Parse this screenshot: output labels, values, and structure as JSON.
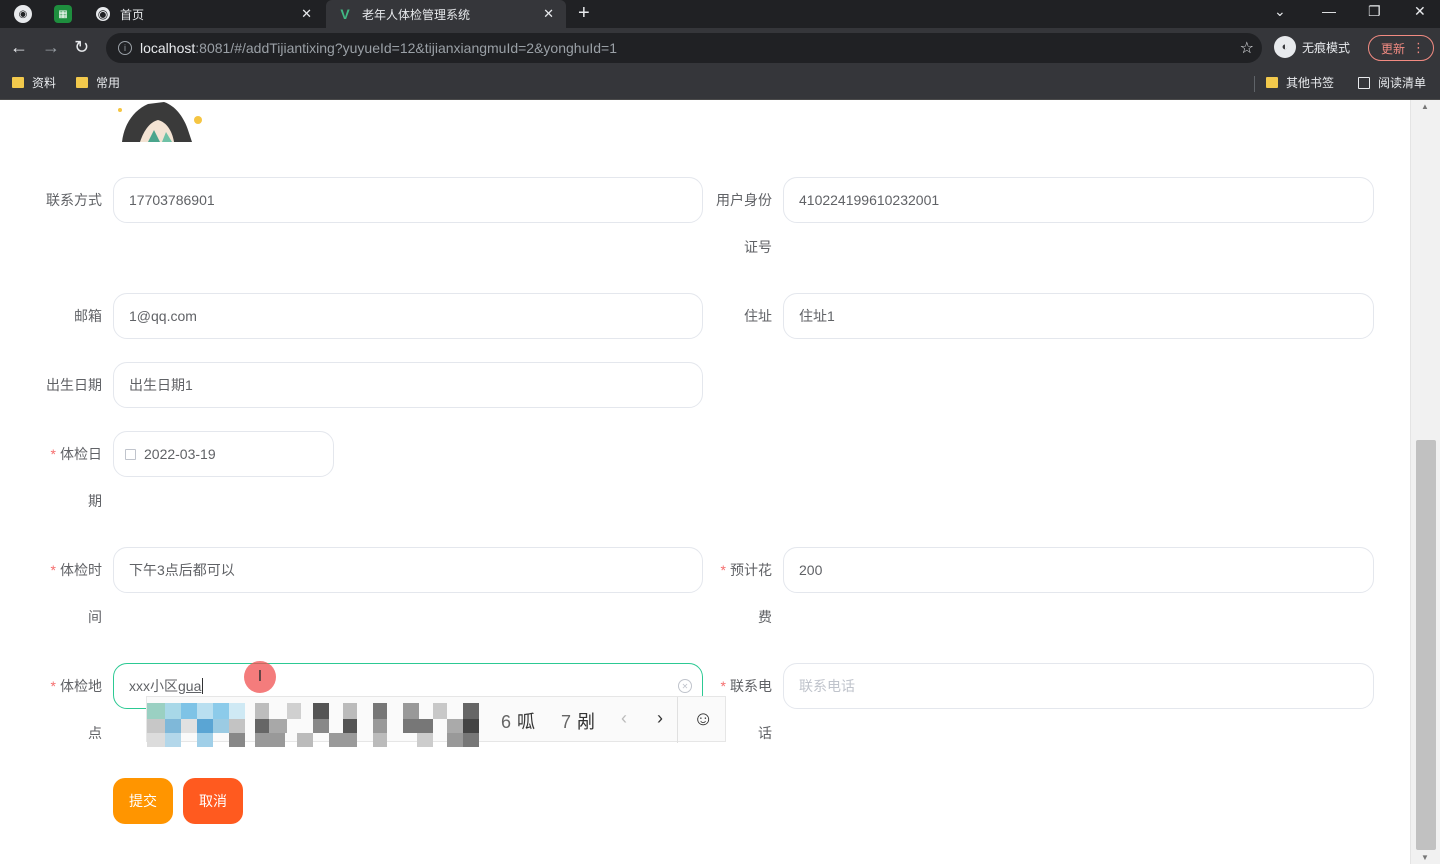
{
  "browser": {
    "tabs": [
      {
        "label": "首页",
        "active": false
      },
      {
        "label": "老年人体检管理系统",
        "active": true
      }
    ],
    "url_host": "localhost",
    "url_rest": ":8081/#/addTijiantixing?yuyueId=12&tijianxiangmuId=2&yonghuId=1",
    "incognito_label": "无痕模式",
    "update_label": "更新",
    "bookmarks": [
      "资料",
      "常用"
    ],
    "bookmarks_right": [
      "其他书签",
      "阅读清单"
    ]
  },
  "form": {
    "contact_label": "联系方式",
    "contact_value": "17703786901",
    "idcard_label_1": "用户身份",
    "idcard_label_2": "证号",
    "idcard_value": "410224199610232001",
    "email_label": "邮箱",
    "email_value": "1@qq.com",
    "address_label": "住址",
    "address_value": "住址1",
    "birthday_label": "出生日期",
    "birthday_value": "出生日期1",
    "required_mark": "*",
    "exam_date_label_1": "体检日",
    "exam_date_label_2": "期",
    "exam_date_value": "2022-03-19",
    "exam_time_label_1": "体检时",
    "exam_time_label_2": "间",
    "exam_time_value": "下午3点后都可以",
    "cost_label_1": "预计花",
    "cost_label_2": "费",
    "cost_value": "200",
    "location_label_1": "体检地",
    "location_label_2": "点",
    "location_value": "xxx小区",
    "location_composing": "gua",
    "phone_label_1": "联系电",
    "phone_label_2": "话",
    "phone_placeholder": "联系电话",
    "submit_label": "提交",
    "cancel_label": "取消"
  },
  "ime": {
    "candidates": [
      {
        "num": "6",
        "text": "呱"
      },
      {
        "num": "7",
        "text": "剐"
      }
    ]
  },
  "colors": {
    "accent_focus": "#2cc993",
    "submit": "#ff9500",
    "cancel": "#ff5a1f",
    "required": "#f56c6c"
  }
}
